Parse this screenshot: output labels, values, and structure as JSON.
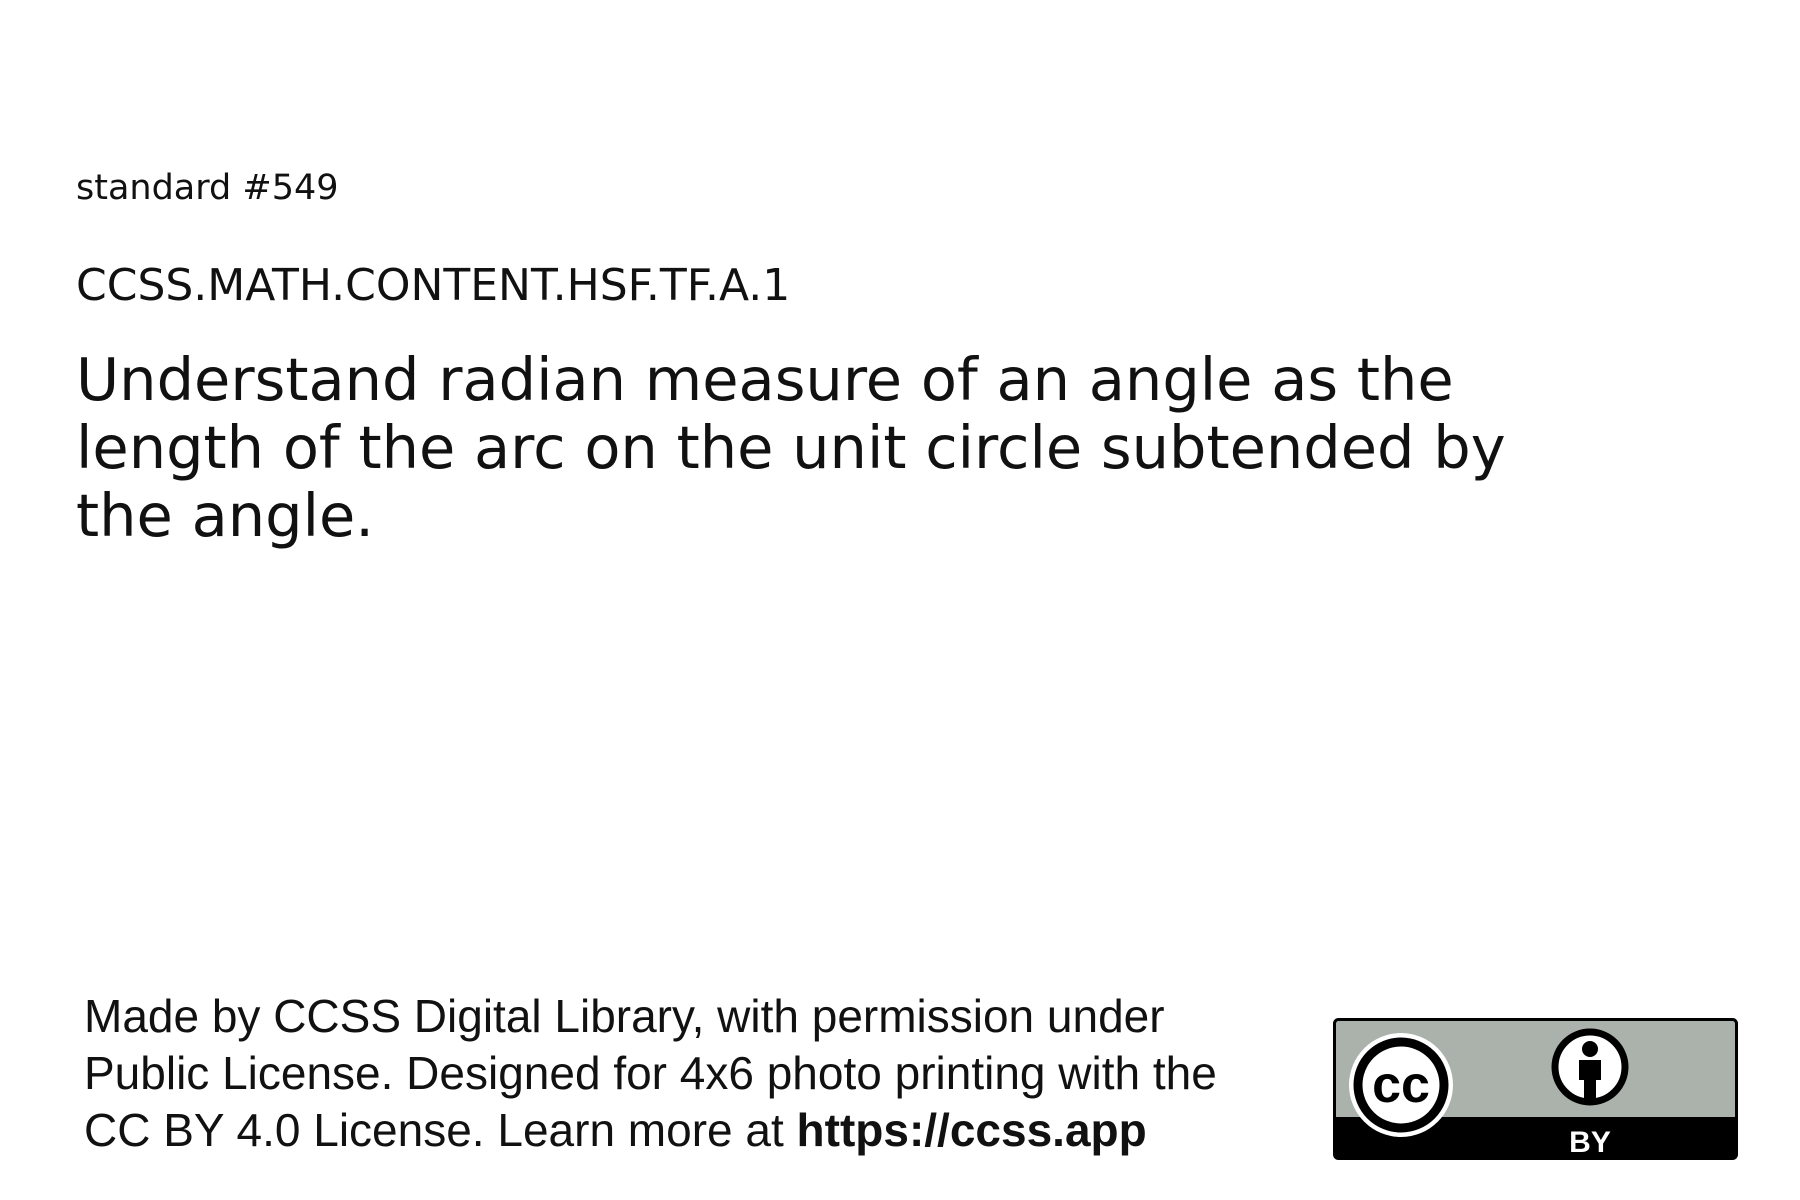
{
  "card": {
    "label": "standard #549",
    "code": "CCSS.MATH.CONTENT.HSF.TF.A.1",
    "statement": "Understand radian measure of an angle as the length of the arc on the unit circle subtended by the angle."
  },
  "footer": {
    "attribution_lines": [
      "Made by CCSS Digital Library, with permission under",
      "Public License. Designed for 4x6 photo printing with the",
      "CC BY 4.0 License. Learn more at "
    ],
    "link_text": "https://ccss.app"
  },
  "license_badge": {
    "cc_text": "cc",
    "by_text": "BY",
    "colors": {
      "badge_fill": "#aab2ab",
      "badge_dark": "#000000",
      "badge_light": "#ffffff"
    }
  }
}
